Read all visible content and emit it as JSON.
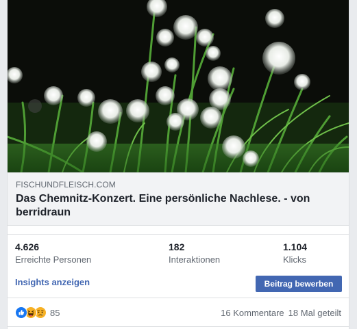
{
  "link_preview": {
    "domain": "FISCHUNDFLEISCH.COM",
    "title": "Das Chemnitz-Konzert. Eine persönliche Nachlese. - von berridraun"
  },
  "stats": [
    {
      "value": "4.626",
      "label": "Erreichte Personen"
    },
    {
      "value": "182",
      "label": "Interaktionen"
    },
    {
      "value": "1.104",
      "label": "Klicks"
    }
  ],
  "actions": {
    "insights_label": "Insights anzeigen",
    "boost_label": "Beitrag bewerben"
  },
  "footer": {
    "reactions": [
      "like-icon",
      "haha-icon",
      "sad-icon"
    ],
    "reaction_count": "85",
    "comments": "16 Kommentare",
    "shares": "18 Mal geteilt"
  },
  "colors": {
    "accent": "#4267b2",
    "like": "#1877f2",
    "emoji": "#f7b125"
  }
}
